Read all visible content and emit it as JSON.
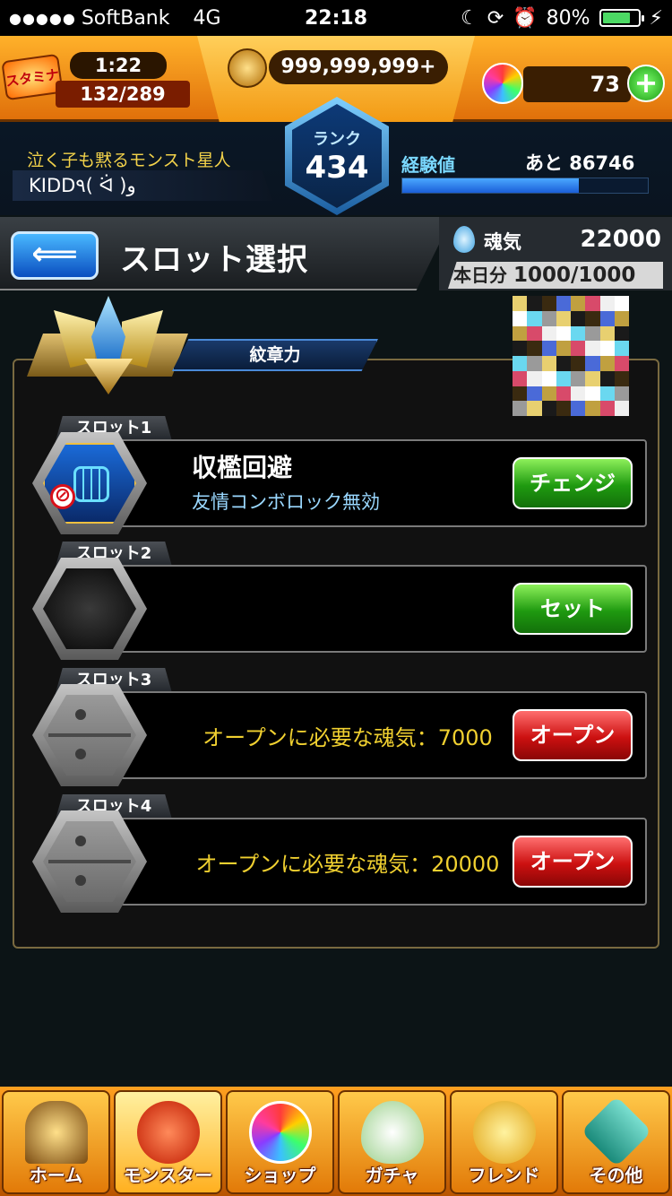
{
  "status_bar": {
    "signal": "●●●●●",
    "carrier": "SoftBank",
    "network": "4G",
    "time": "22:18",
    "battery": "80%",
    "battery_level": 0.8
  },
  "header": {
    "stamina_label": "スタミナ",
    "stamina_timer": "1:22",
    "stamina": "132/289",
    "coins": "999,999,999+",
    "orbs": "73",
    "orb_add": "+",
    "rank_label": "ランク",
    "rank": "434",
    "player_title": "泣く子も黙るモンスト星人",
    "player_name": "KIDD٩( ᐛ )و",
    "exp_label": "経験値",
    "exp_remaining": "あと 86746",
    "exp_progress": 0.72
  },
  "title_bar": {
    "back_label": "⟸",
    "title": "スロット選択",
    "soul_label": "魂気",
    "soul_value": "22000",
    "daily_label": "本日分",
    "daily_value": "1000/1000"
  },
  "crest_power_label": "紋章力",
  "slots": [
    {
      "tab": "スロット1",
      "name": "収檻回避",
      "desc": "友情コンボロック無効",
      "action": "チェンジ"
    },
    {
      "tab": "スロット2",
      "action": "セット"
    },
    {
      "tab": "スロット3",
      "cost": "オープンに必要な魂気：7000",
      "action": "オープン"
    },
    {
      "tab": "スロット4",
      "cost": "オープンに必要な魂気：20000",
      "action": "オープン"
    }
  ],
  "bottom_nav": [
    {
      "label": "ホーム"
    },
    {
      "label": "モンスター"
    },
    {
      "label": "ショップ"
    },
    {
      "label": "ガチャ"
    },
    {
      "label": "フレンド"
    },
    {
      "label": "その他"
    }
  ],
  "colors": {
    "accent_orange": "#f39a14",
    "button_green": "#1f9a10",
    "button_red": "#cc1010",
    "cost_text": "#f0d030"
  }
}
